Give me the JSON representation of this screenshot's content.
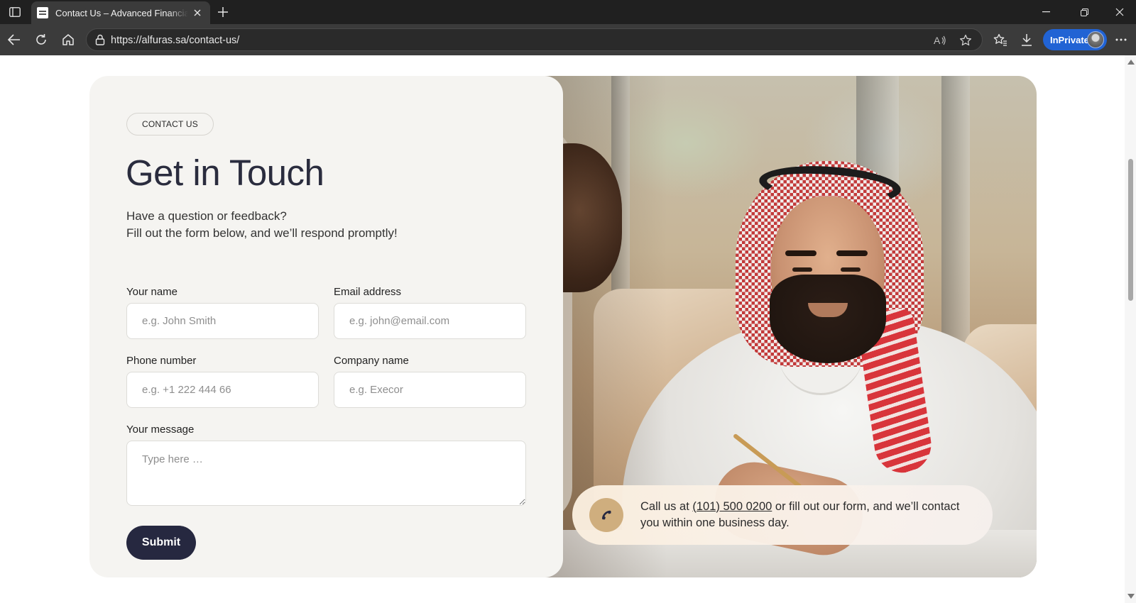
{
  "browser": {
    "tab_title": "Contact Us – Advanced Financial Company",
    "url": "https://alfuras.sa/contact-us/",
    "inprivate_label": "InPrivate"
  },
  "colors": {
    "form_panel_bg": "#f5f4f1",
    "heading": "#2a2c3e",
    "submit_bg": "#262840",
    "phone_badge": "#cfae7e",
    "browser_chrome": "#3b3b3b",
    "inprivate_badge": "#2163d4"
  },
  "contact": {
    "eyebrow": "CONTACT US",
    "heading": "Get in Touch",
    "intro_line1": "Have a question or feedback?",
    "intro_line2": "Fill out the form below, and we’ll respond promptly!",
    "form": {
      "name_label": "Your name",
      "name_placeholder": "e.g. John Smith",
      "email_label": "Email address",
      "email_placeholder": "e.g. john@email.com",
      "phone_label": "Phone number",
      "phone_placeholder": "e.g. +1 222 444 66",
      "company_label": "Company name",
      "company_placeholder": "e.g. Execor",
      "message_label": "Your message",
      "message_placeholder": "Type here …",
      "submit_label": "Submit"
    },
    "callout": {
      "text_before": "Call us at ",
      "phone_link": "(101) 500 0200",
      "text_after": " or fill out our form, and we’ll contact you within one business day.",
      "icon": "phone-icon"
    }
  },
  "photo": {
    "alt": "Smiling man in white thobe and red-checked ghutra writing at a table"
  }
}
